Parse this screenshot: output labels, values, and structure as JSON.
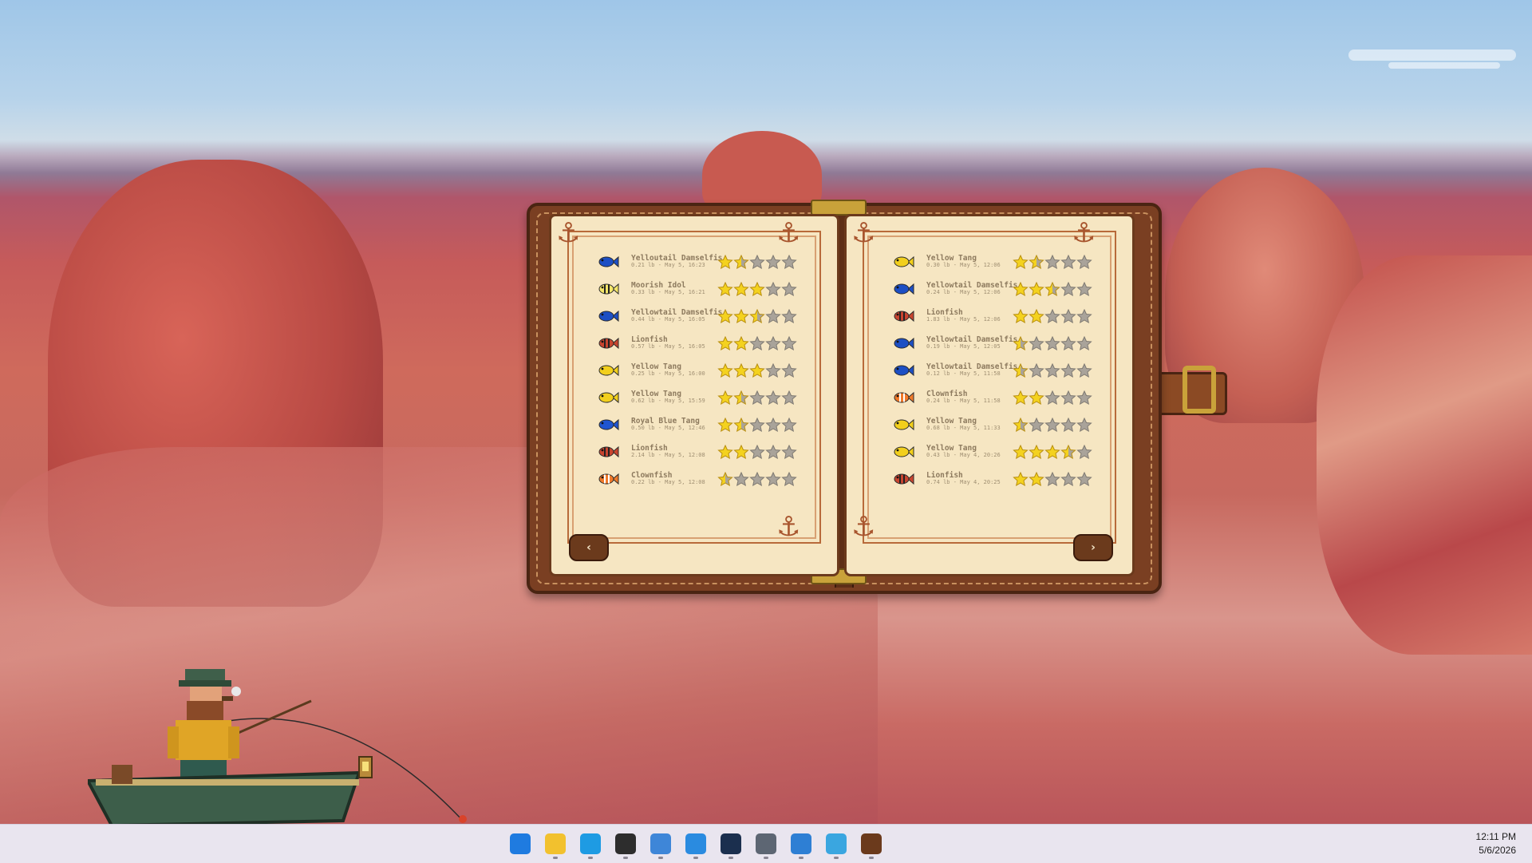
{
  "book": {
    "left_page": [
      {
        "name": "Yelloutail Damselfis",
        "meta": "0.21 lb - May 5, 16:23",
        "fish": "yellowtail-damselfish",
        "stars": 1.5
      },
      {
        "name": "Moorish Idol",
        "meta": "0.33 lb - May 5, 16:21",
        "fish": "moorish-idol",
        "stars": 3
      },
      {
        "name": "Yellowtail Damselfis",
        "meta": "0.44 lb - May 5, 16:05",
        "fish": "yellowtail-damselfish",
        "stars": 2.5
      },
      {
        "name": "Lionfish",
        "meta": "0.57 lb - May 5, 16:05",
        "fish": "lionfish",
        "stars": 2
      },
      {
        "name": "Yellow Tang",
        "meta": "0.25 lb - May 5, 16:00",
        "fish": "yellow-tang",
        "stars": 3
      },
      {
        "name": "Yellow Tang",
        "meta": "0.62 lb - May 5, 15:59",
        "fish": "yellow-tang",
        "stars": 1.5
      },
      {
        "name": "Royal Blue Tang",
        "meta": "0.50 lb - May 5, 12:46",
        "fish": "royal-blue-tang",
        "stars": 1.5
      },
      {
        "name": "Lionfish",
        "meta": "2.14 lb - May 5, 12:08",
        "fish": "lionfish",
        "stars": 2
      },
      {
        "name": "Clownfish",
        "meta": "0.22 lb - May 5, 12:08",
        "fish": "clownfish",
        "stars": 0.5
      }
    ],
    "right_page": [
      {
        "name": "Yellow Tang",
        "meta": "0.30 lb - May 5, 12:06",
        "fish": "yellow-tang",
        "stars": 1.5
      },
      {
        "name": "Yellowtail Damselfis",
        "meta": "0.24 lb - May 5, 12:06",
        "fish": "yellowtail-damselfish",
        "stars": 2.5
      },
      {
        "name": "Lionfish",
        "meta": "1.83 lb - May 5, 12:06",
        "fish": "lionfish",
        "stars": 2
      },
      {
        "name": "Yellowtail Damselfis",
        "meta": "0.19 lb - May 5, 12:05",
        "fish": "yellowtail-damselfish",
        "stars": 0.5
      },
      {
        "name": "Yellowtail Damselfis",
        "meta": "0.12 lb - May 5, 11:58",
        "fish": "yellowtail-damselfish",
        "stars": 0.5
      },
      {
        "name": "Clownfish",
        "meta": "0.24 lb - May 5, 11:58",
        "fish": "clownfish",
        "stars": 2
      },
      {
        "name": "Yellow Tang",
        "meta": "0.68 lb - May 5, 11:33",
        "fish": "yellow-tang",
        "stars": 0.5
      },
      {
        "name": "Yellow Tang",
        "meta": "0.43 lb - May 4, 20:26",
        "fish": "yellow-tang",
        "stars": 3.5
      },
      {
        "name": "Lionfish",
        "meta": "0.74 lb - May 4, 20:25",
        "fish": "lionfish",
        "stars": 2
      }
    ],
    "prev_label": "‹",
    "next_label": "›"
  },
  "colors": {
    "star_filled": "#f4d21f",
    "star_empty": "#a9a39a",
    "yellow-tang": "#f2cf1c",
    "yellowtail-damselfish": "#1d4fc4",
    "moorish-idol": "#f5e66a",
    "lionfish": "#c8452f",
    "royal-blue-tang": "#1f55d0",
    "clownfish": "#f07a2a"
  },
  "taskbar": {
    "icons": [
      {
        "name": "start-icon",
        "color": "#1f7be0"
      },
      {
        "name": "file-explorer-icon",
        "color": "#f2c12e"
      },
      {
        "name": "edge-icon",
        "color": "#1e9be3"
      },
      {
        "name": "terminal-icon",
        "color": "#2d2d2d"
      },
      {
        "name": "notepad-icon",
        "color": "#3e86d8"
      },
      {
        "name": "vscode-icon",
        "color": "#2a8be0"
      },
      {
        "name": "steam-icon",
        "color": "#1b2f4e"
      },
      {
        "name": "calculator-icon",
        "color": "#5d6673"
      },
      {
        "name": "paint-icon",
        "color": "#2e7fd4"
      },
      {
        "name": "maps-icon",
        "color": "#3aa6e0"
      },
      {
        "name": "fisherman-app-icon",
        "color": "#6b3a1c"
      }
    ],
    "time": "12:11 PM",
    "date": "5/6/2026"
  }
}
